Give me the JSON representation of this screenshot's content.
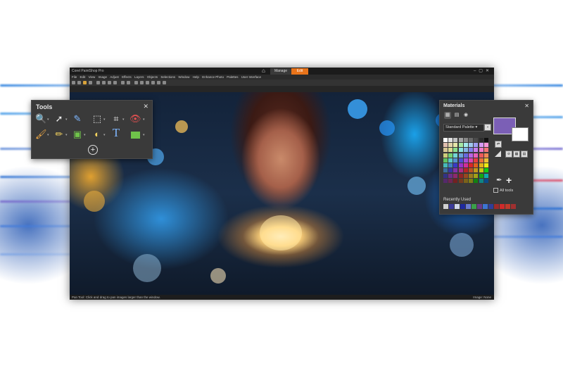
{
  "app": {
    "title": "Corel PaintShop Pro",
    "tabs": [
      {
        "label": "Manage"
      },
      {
        "label": "Edit"
      }
    ],
    "menu": [
      "File",
      "Edit",
      "View",
      "Image",
      "Adjust",
      "Effects",
      "Layers",
      "Objects",
      "Selections",
      "Window",
      "Help",
      "Enhance Photo",
      "Palettes",
      "User Interface"
    ],
    "status_left": "Pan Tool: Click and drag to pan images larger than the window.",
    "status_right": "Image: None"
  },
  "tools_palette": {
    "title": "Tools",
    "icons": [
      "zoom-icon",
      "pointer-icon",
      "dropper-icon",
      "selection-icon",
      "crop-icon",
      "red-eye-icon",
      "brush-icon",
      "pencil-icon",
      "clone-icon",
      "fill-icon",
      "text-icon",
      "rectangle-shape-icon"
    ],
    "accent": "#6fc34a"
  },
  "materials_palette": {
    "title": "Materials",
    "palette_select": "Standard Palette",
    "all_tools_label": "All tools",
    "recently_used_label": "Recently Used",
    "foreground_color": "#7b5fb6",
    "background_color": "#ffffff",
    "recent_colors": [
      "#d0d0d0",
      "#3b3b9b",
      "#cfd7ea",
      "#1f2aa0",
      "#6a7bd0",
      "#3aa04a",
      "#6b3a8a",
      "#3c74d2",
      "#2f3e9a",
      "#9b2a2a",
      "#d02a2a",
      "#c03a2a",
      "#a03030"
    ]
  }
}
